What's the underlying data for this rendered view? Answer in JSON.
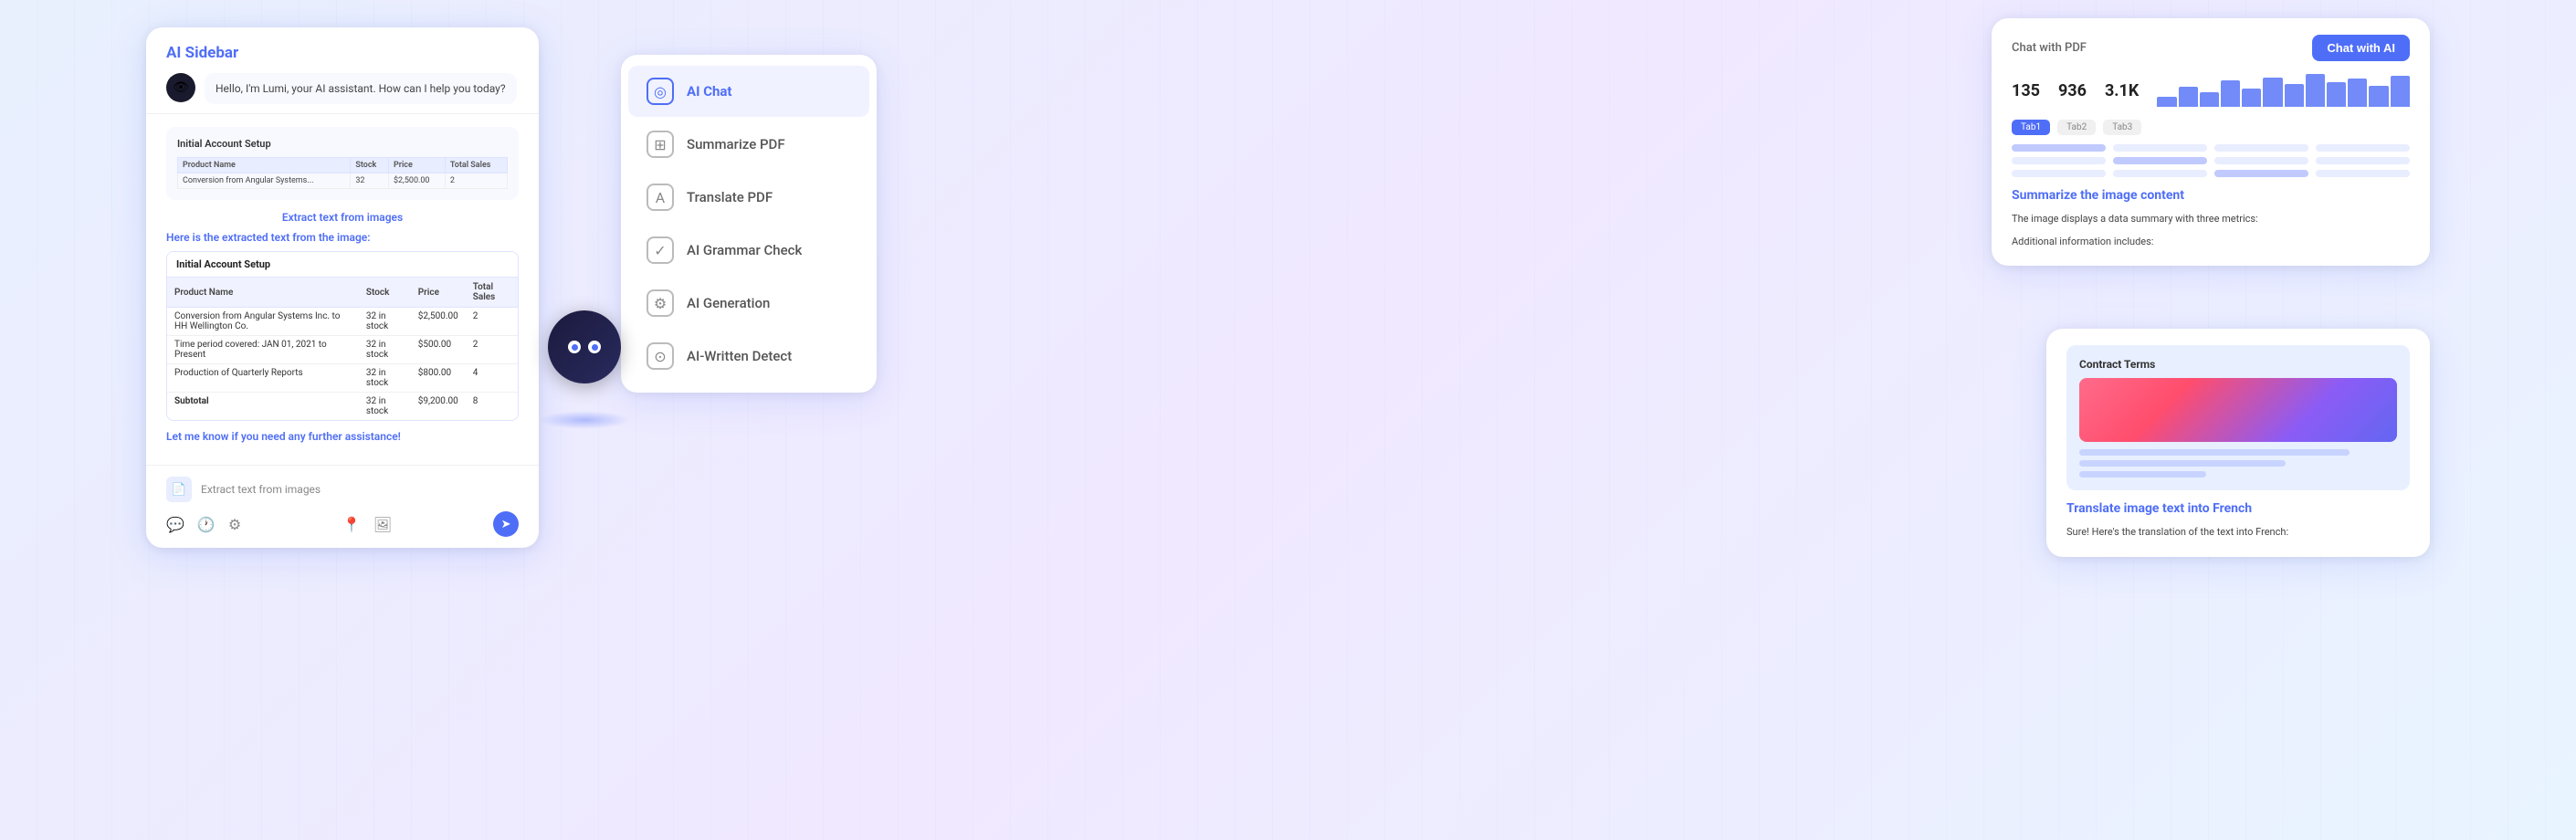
{
  "background": {
    "gradient_start": "#e8f0fe",
    "gradient_end": "#f0e8ff"
  },
  "ai_sidebar": {
    "title": "AI Sidebar",
    "greeting": "Hello, I'm Lumi, your AI assistant. How can I help you today?",
    "extract_link": "Extract text from images",
    "extracted_label": "Here is the extracted text from the image:",
    "table_title": "Initial Account Setup",
    "table_headers": [
      "Product Name",
      "Stock",
      "Price",
      "Total Sales"
    ],
    "table_rows": [
      [
        "Conversion from Angular Systems Inc. to HH Wellington Co.",
        "32 in stock",
        "$2,500.00",
        "2"
      ],
      [
        "Time period covered: JAN 01, 2021 to Present",
        "32 in stock",
        "$500.00",
        "2"
      ],
      [
        "Production of Quarterly Reports",
        "32 in stock",
        "$800.00",
        "4"
      ],
      [
        "Subtotal",
        "32 in stock",
        "$9,200.00",
        "8"
      ]
    ],
    "further_text": "Let me know if you need any further assistance!",
    "footer_input": "Extract text from images",
    "send_icon": "➤"
  },
  "ai_chat_menu": {
    "items": [
      {
        "label": "AI Chat",
        "icon": "◎",
        "active": true
      },
      {
        "label": "Summarize PDF",
        "icon": "⊞",
        "active": false
      },
      {
        "label": "Translate PDF",
        "icon": "A",
        "active": false
      },
      {
        "label": "AI Grammar Check",
        "icon": "✓",
        "active": false
      },
      {
        "label": "AI Generation",
        "icon": "⚙",
        "active": false
      },
      {
        "label": "AI-Written Detect",
        "icon": "⊙",
        "active": false
      }
    ]
  },
  "chat_pdf_card": {
    "title": "Chat with PDF",
    "button_label": "Chat with AI",
    "stats": [
      {
        "value": "135",
        "label": ""
      },
      {
        "value": "936",
        "label": ""
      },
      {
        "value": "3.1K",
        "label": ""
      }
    ],
    "tabs": [
      "Tab1",
      "Tab2",
      "Tab3"
    ],
    "summarize_link": "Summarize the image content",
    "summary_text": "The image displays a data summary with three metrics:",
    "summary_subtext": "Additional information includes:"
  },
  "contract_card": {
    "title": "Contract Terms",
    "translate_link": "Translate image text into French",
    "translation_text": "Sure! Here's the translation of the text into French:"
  },
  "robot": {
    "label": "Lumi AI Mascot"
  }
}
